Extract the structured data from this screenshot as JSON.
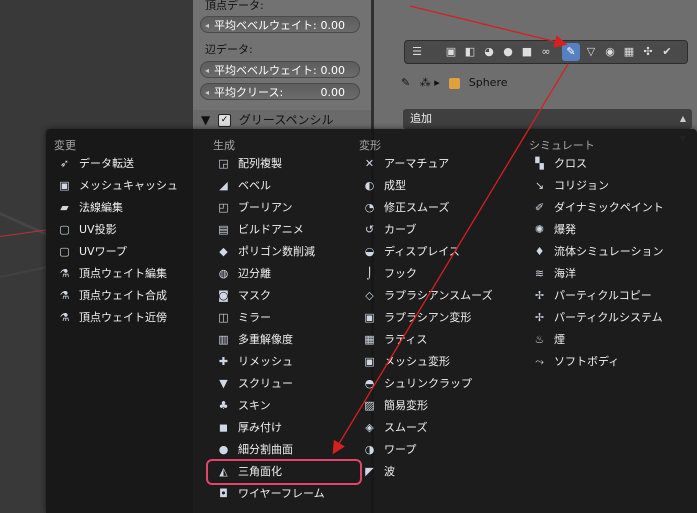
{
  "props": {
    "vertex_data_label": "頂点データ:",
    "vertex_bevel_label": "平均ベベルウェイト:",
    "vertex_bevel_value": "0.00",
    "edge_data_label": "辺データ:",
    "edge_bevel_label": "平均ベベルウェイト:",
    "edge_bevel_value": "0.00",
    "edge_crease_label": "平均クリース:",
    "edge_crease_value": "0.00",
    "grease_pencil_label": "グリースペンシル"
  },
  "header": {
    "breadcrumb_object": "Sphere",
    "add_label": "追加"
  },
  "menu": {
    "columns": [
      {
        "title": "変更",
        "items": [
          {
            "label": "データ転送",
            "icon": "data-transfer-icon"
          },
          {
            "label": "メッシュキャッシュ",
            "icon": "mesh-cache-icon"
          },
          {
            "label": "法線編集",
            "icon": "normal-edit-icon"
          },
          {
            "label": "UV投影",
            "icon": "uv-project-icon"
          },
          {
            "label": "UVワープ",
            "icon": "uv-warp-icon"
          },
          {
            "label": "頂点ウェイト編集",
            "icon": "vertex-weight-edit-icon"
          },
          {
            "label": "頂点ウェイト合成",
            "icon": "vertex-weight-mix-icon"
          },
          {
            "label": "頂点ウェイト近傍",
            "icon": "vertex-weight-proximity-icon"
          }
        ]
      },
      {
        "title": "生成",
        "items": [
          {
            "label": "配列複製",
            "icon": "array-icon"
          },
          {
            "label": "ベベル",
            "icon": "bevel-icon"
          },
          {
            "label": "ブーリアン",
            "icon": "boolean-icon"
          },
          {
            "label": "ビルドアニメ",
            "icon": "build-icon"
          },
          {
            "label": "ポリゴン数削減",
            "icon": "decimate-icon"
          },
          {
            "label": "辺分離",
            "icon": "edge-split-icon"
          },
          {
            "label": "マスク",
            "icon": "mask-icon"
          },
          {
            "label": "ミラー",
            "icon": "mirror-icon"
          },
          {
            "label": "多重解像度",
            "icon": "multires-icon"
          },
          {
            "label": "リメッシュ",
            "icon": "remesh-icon"
          },
          {
            "label": "スクリュー",
            "icon": "screw-icon"
          },
          {
            "label": "スキン",
            "icon": "skin-icon"
          },
          {
            "label": "厚み付け",
            "icon": "solidify-icon"
          },
          {
            "label": "細分割曲面",
            "icon": "subsurf-icon"
          },
          {
            "label": "三角面化",
            "icon": "triangulate-icon"
          },
          {
            "label": "ワイヤーフレーム",
            "icon": "wireframe-icon"
          }
        ]
      },
      {
        "title": "変形",
        "items": [
          {
            "label": "アーマチュア",
            "icon": "armature-icon"
          },
          {
            "label": "成型",
            "icon": "cast-icon"
          },
          {
            "label": "修正スムーズ",
            "icon": "corrective-smooth-icon"
          },
          {
            "label": "カーブ",
            "icon": "curve-icon"
          },
          {
            "label": "ディスプレイス",
            "icon": "displace-icon"
          },
          {
            "label": "フック",
            "icon": "hook-icon"
          },
          {
            "label": "ラプラシアンスムーズ",
            "icon": "laplacian-smooth-icon"
          },
          {
            "label": "ラプラシアン変形",
            "icon": "laplacian-deform-icon"
          },
          {
            "label": "ラティス",
            "icon": "lattice-icon"
          },
          {
            "label": "メッシュ変形",
            "icon": "mesh-deform-icon"
          },
          {
            "label": "シュリンクラップ",
            "icon": "shrinkwrap-icon"
          },
          {
            "label": "簡易変形",
            "icon": "simple-deform-icon"
          },
          {
            "label": "スムーズ",
            "icon": "smooth-icon"
          },
          {
            "label": "ワープ",
            "icon": "warp-icon"
          },
          {
            "label": "波",
            "icon": "wave-icon"
          }
        ]
      },
      {
        "title": "シミュレート",
        "items": [
          {
            "label": "クロス",
            "icon": "cloth-icon"
          },
          {
            "label": "コリジョン",
            "icon": "collision-icon"
          },
          {
            "label": "ダイナミックペイント",
            "icon": "dynamic-paint-icon"
          },
          {
            "label": "爆発",
            "icon": "explode-icon"
          },
          {
            "label": "流体シミュレーション",
            "icon": "fluid-icon"
          },
          {
            "label": "海洋",
            "icon": "ocean-icon"
          },
          {
            "label": "パーティクルコピー",
            "icon": "particle-instance-icon"
          },
          {
            "label": "パーティクルシステム",
            "icon": "particle-system-icon"
          },
          {
            "label": "煙",
            "icon": "smoke-icon"
          },
          {
            "label": "ソフトボディ",
            "icon": "soft-body-icon"
          }
        ]
      }
    ],
    "highlighted_item": "三角面化"
  },
  "colors": {
    "highlight_outline": "#e2456a",
    "annotation_arrow": "#d62020",
    "active_tab": "#5680c2"
  }
}
